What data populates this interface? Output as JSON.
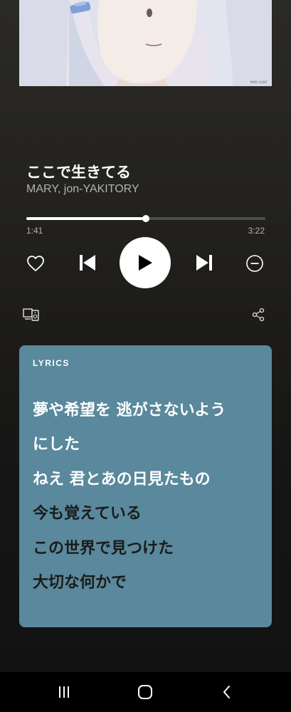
{
  "now_playing": {
    "title": "ここで生きてる",
    "artist": "MARY, jon-YAKITORY",
    "art_credit": "MMD ©JOKT"
  },
  "progress": {
    "elapsed": "1:41",
    "total": "3:22",
    "fraction": 0.5
  },
  "controls": {
    "like_icon": "heart-icon",
    "previous_icon": "skip-previous-icon",
    "play_icon": "play-icon",
    "next_icon": "skip-next-icon",
    "hide_icon": "minus-circle-icon",
    "devices_icon": "connect-devices-icon",
    "share_icon": "share-icon"
  },
  "lyrics": {
    "header": "LYRICS",
    "card_color": "#5a889c",
    "lines": [
      {
        "text": "夢や希望を 逃がさないよう",
        "state": "active"
      },
      {
        "text": "にした",
        "state": "active"
      },
      {
        "text": "ねえ 君とあの日見たもの",
        "state": "active"
      },
      {
        "text": "今も覚えている",
        "state": "upcoming"
      },
      {
        "text": "この世界で見つけた",
        "state": "upcoming"
      },
      {
        "text": "大切な何かで",
        "state": "upcoming"
      }
    ]
  },
  "system_nav": {
    "recents_icon": "recents-icon",
    "home_icon": "home-icon",
    "back_icon": "back-icon"
  }
}
